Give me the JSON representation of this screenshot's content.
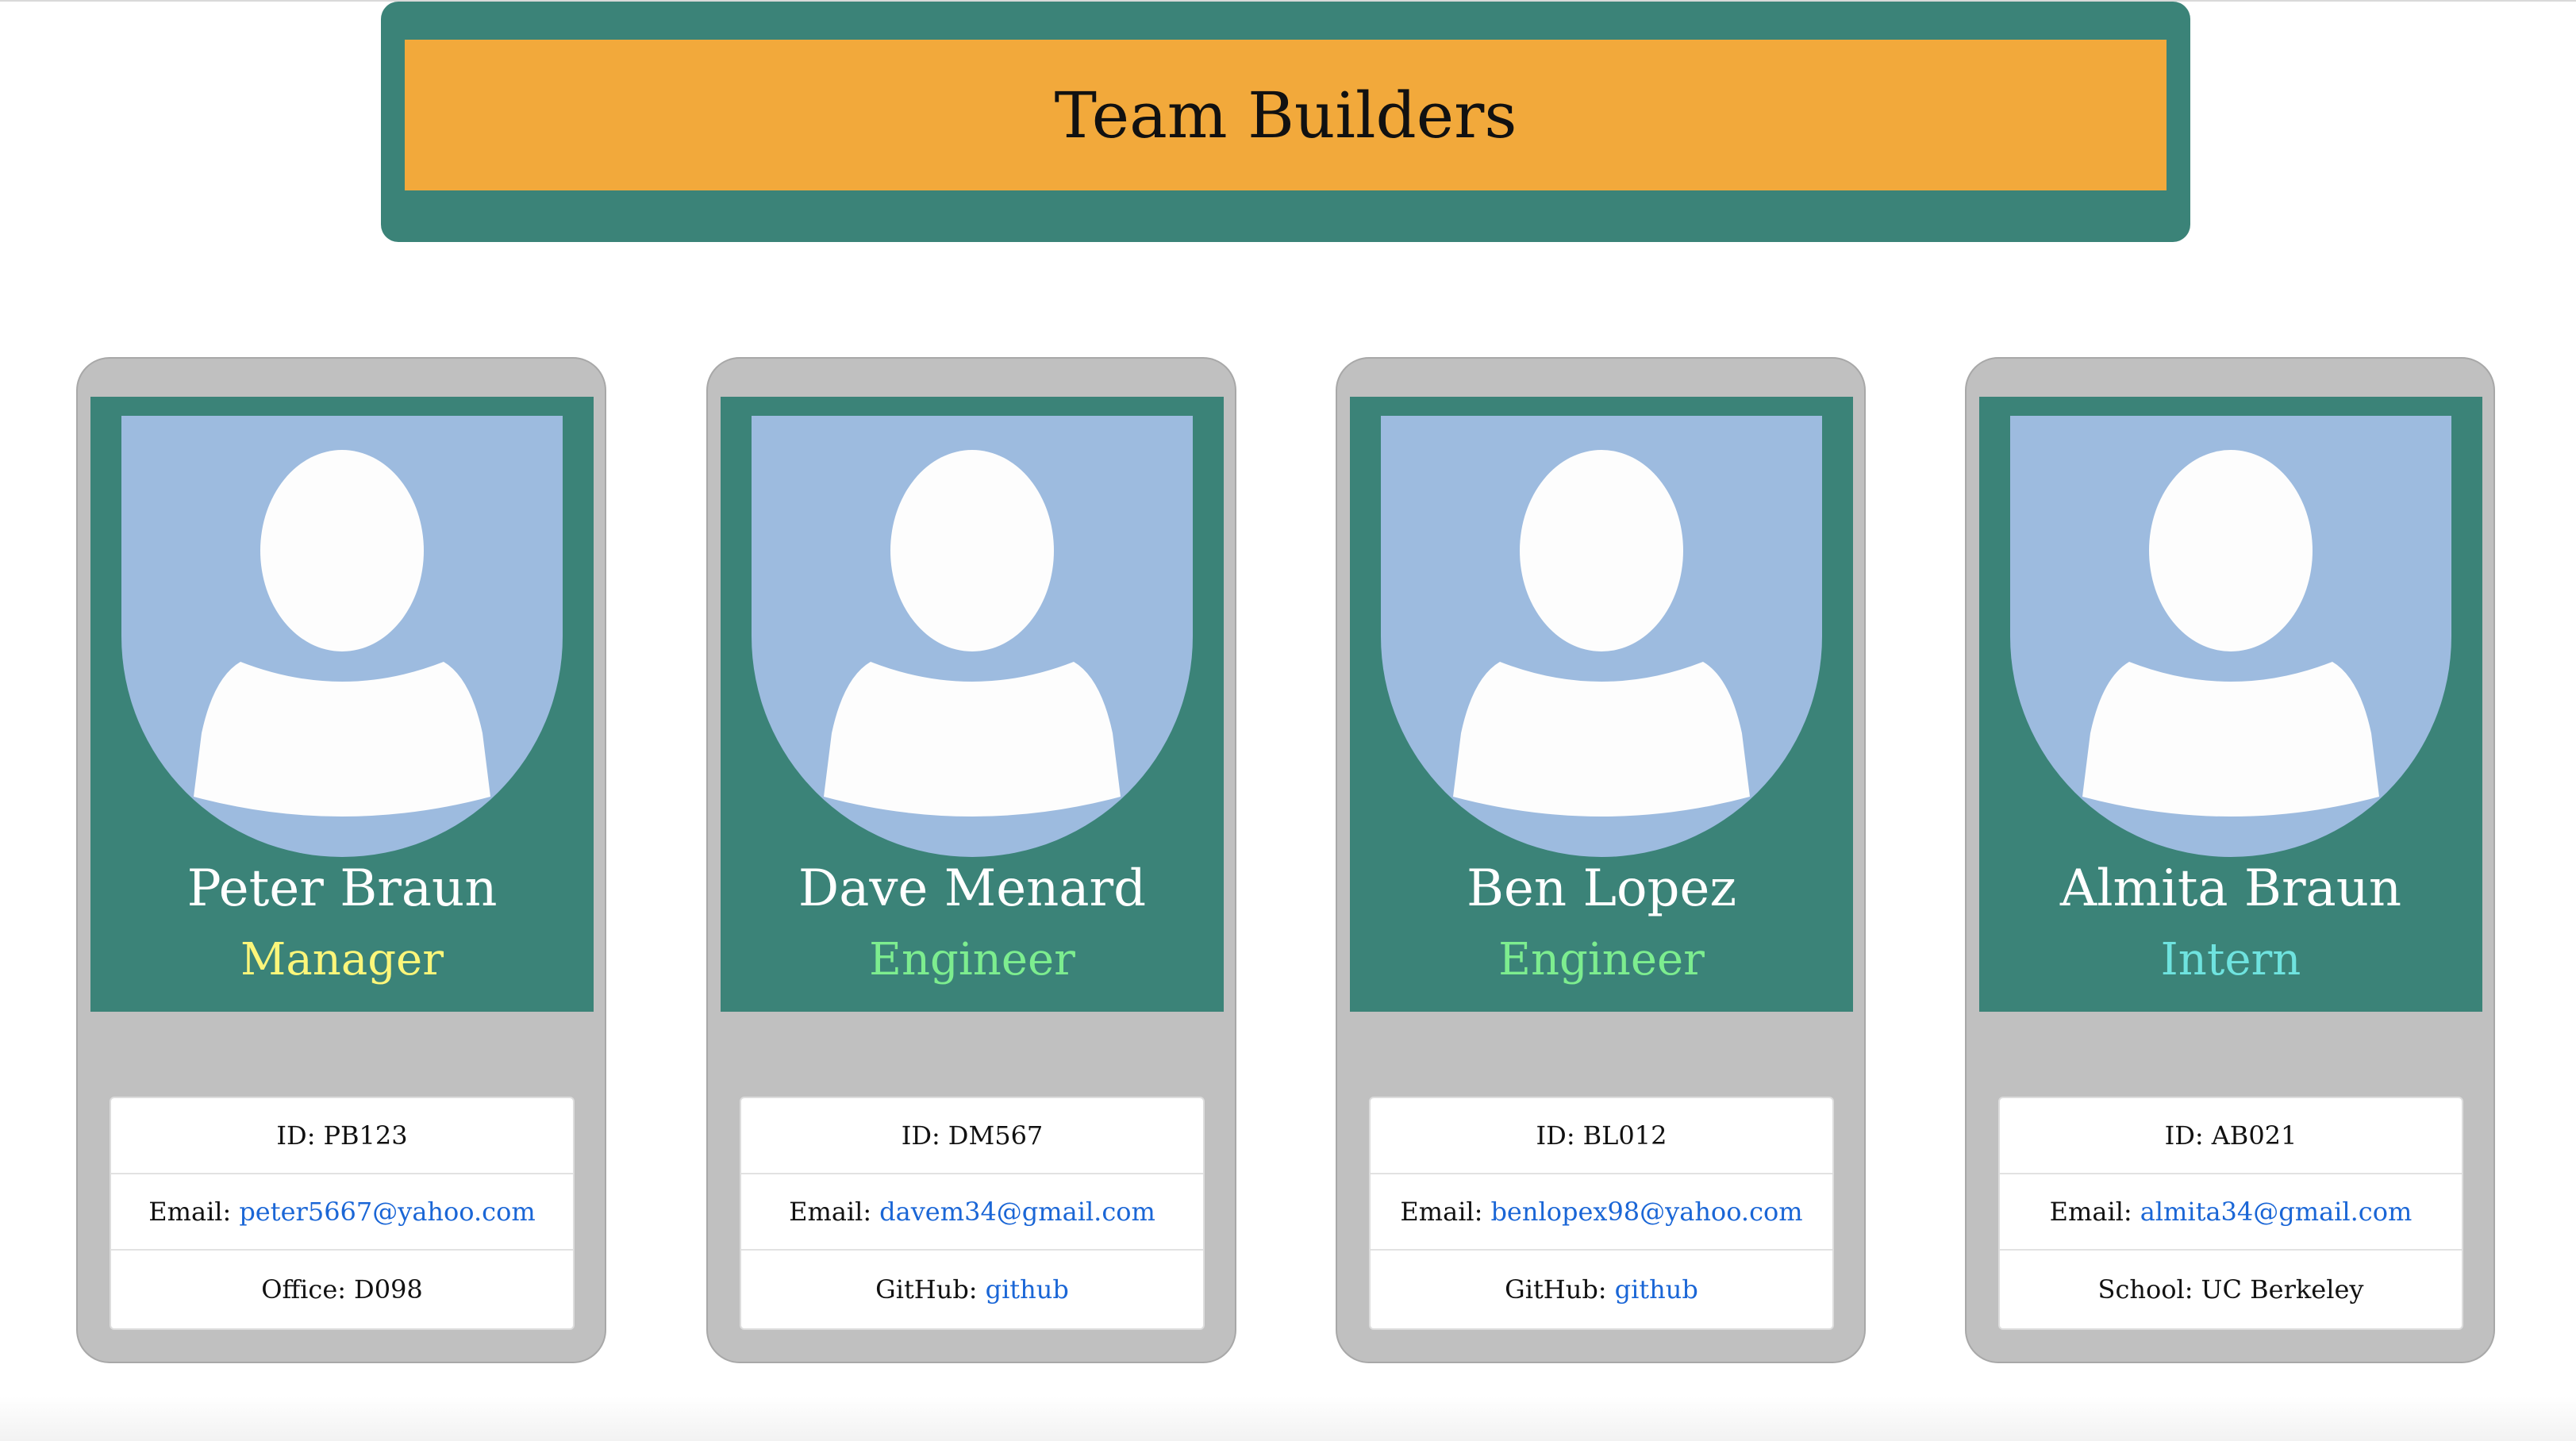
{
  "header": {
    "title": "Team Builders"
  },
  "colors": {
    "header_frame": "#3b8378",
    "header_bar": "#f2a93b",
    "card_bg": "#c0c0c0",
    "card_top": "#3b8378",
    "avatar_bg": "#9dbbdf",
    "manager_role": "#fcf67a",
    "engineer_role": "#7ded8f",
    "intern_role": "#6fe3df",
    "link": "#1a66d6"
  },
  "cards": [
    {
      "name": "Peter Braun",
      "role": "Manager",
      "avatar_icon": "user-silhouette-icon",
      "id_label": "ID:",
      "id_value": "PB123",
      "email_label": "Email:",
      "email_value": "peter5667@yahoo.com",
      "extra_label": "Office:",
      "extra_value": "D098"
    },
    {
      "name": "Dave Menard",
      "role": "Engineer",
      "avatar_icon": "user-silhouette-icon",
      "id_label": "ID:",
      "id_value": "DM567",
      "email_label": "Email:",
      "email_value": "davem34@gmail.com",
      "extra_label": "GitHub:",
      "extra_value": "github"
    },
    {
      "name": "Ben Lopez",
      "role": "Engineer",
      "avatar_icon": "user-silhouette-icon",
      "id_label": "ID:",
      "id_value": "BL012",
      "email_label": "Email:",
      "email_value": "benlopex98@yahoo.com",
      "extra_label": "GitHub:",
      "extra_value": "github"
    },
    {
      "name": "Almita Braun",
      "role": "Intern",
      "avatar_icon": "user-silhouette-icon",
      "id_label": "ID:",
      "id_value": "AB021",
      "email_label": "Email:",
      "email_value": "almita34@gmail.com",
      "extra_label": "School:",
      "extra_value": "UC Berkeley"
    }
  ]
}
